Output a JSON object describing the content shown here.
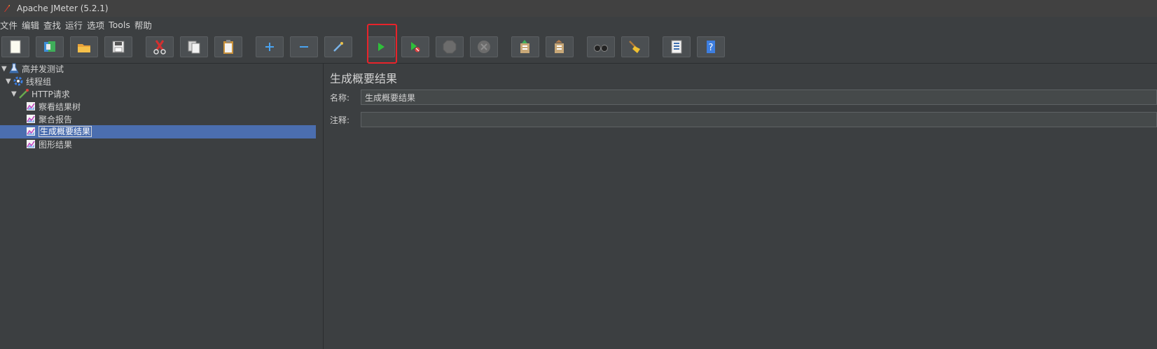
{
  "window": {
    "title": "Apache JMeter (5.2.1)"
  },
  "menu": [
    "文件",
    "编辑",
    "查找",
    "运行",
    "选项",
    "Tools",
    "帮助"
  ],
  "toolbar": {
    "buttons": [
      {
        "name": "new-icon"
      },
      {
        "name": "templates-icon"
      },
      {
        "name": "open-icon"
      },
      {
        "name": "save-icon"
      },
      {
        "name": "cut-icon"
      },
      {
        "name": "copy-icon"
      },
      {
        "name": "paste-icon"
      },
      {
        "name": "expand-icon"
      },
      {
        "name": "collapse-icon"
      },
      {
        "name": "toggle-icon"
      },
      {
        "name": "start-icon"
      },
      {
        "name": "start-no-timers-icon"
      },
      {
        "name": "stop-icon"
      },
      {
        "name": "shutdown-icon"
      },
      {
        "name": "remote-start-icon"
      },
      {
        "name": "remote-stop-icon"
      },
      {
        "name": "search-icon"
      },
      {
        "name": "clear-all-icon"
      },
      {
        "name": "function-helper-icon"
      },
      {
        "name": "help-icon"
      }
    ],
    "highlighted": "start-icon",
    "highlight_color": "#e8232a"
  },
  "tree": {
    "items": [
      {
        "label": "高并发测试",
        "icon": "test-plan-icon",
        "level": 0
      },
      {
        "label": "线程组",
        "icon": "thread-group-icon",
        "level": 1
      },
      {
        "label": "HTTP请求",
        "icon": "sampler-icon",
        "level": 2
      },
      {
        "label": "察看结果树",
        "icon": "listener-icon",
        "level": 3
      },
      {
        "label": "聚合报告",
        "icon": "listener-icon",
        "level": 3
      },
      {
        "label": "生成概要结果",
        "icon": "listener-icon",
        "level": 3,
        "selected": true
      },
      {
        "label": "图形结果",
        "icon": "listener-icon",
        "level": 3
      }
    ],
    "selected_color": "#4b6eaf"
  },
  "panel": {
    "title": "生成概要结果",
    "name_label": "名称:",
    "name_value": "生成概要结果",
    "comment_label": "注释:",
    "comment_value": ""
  }
}
